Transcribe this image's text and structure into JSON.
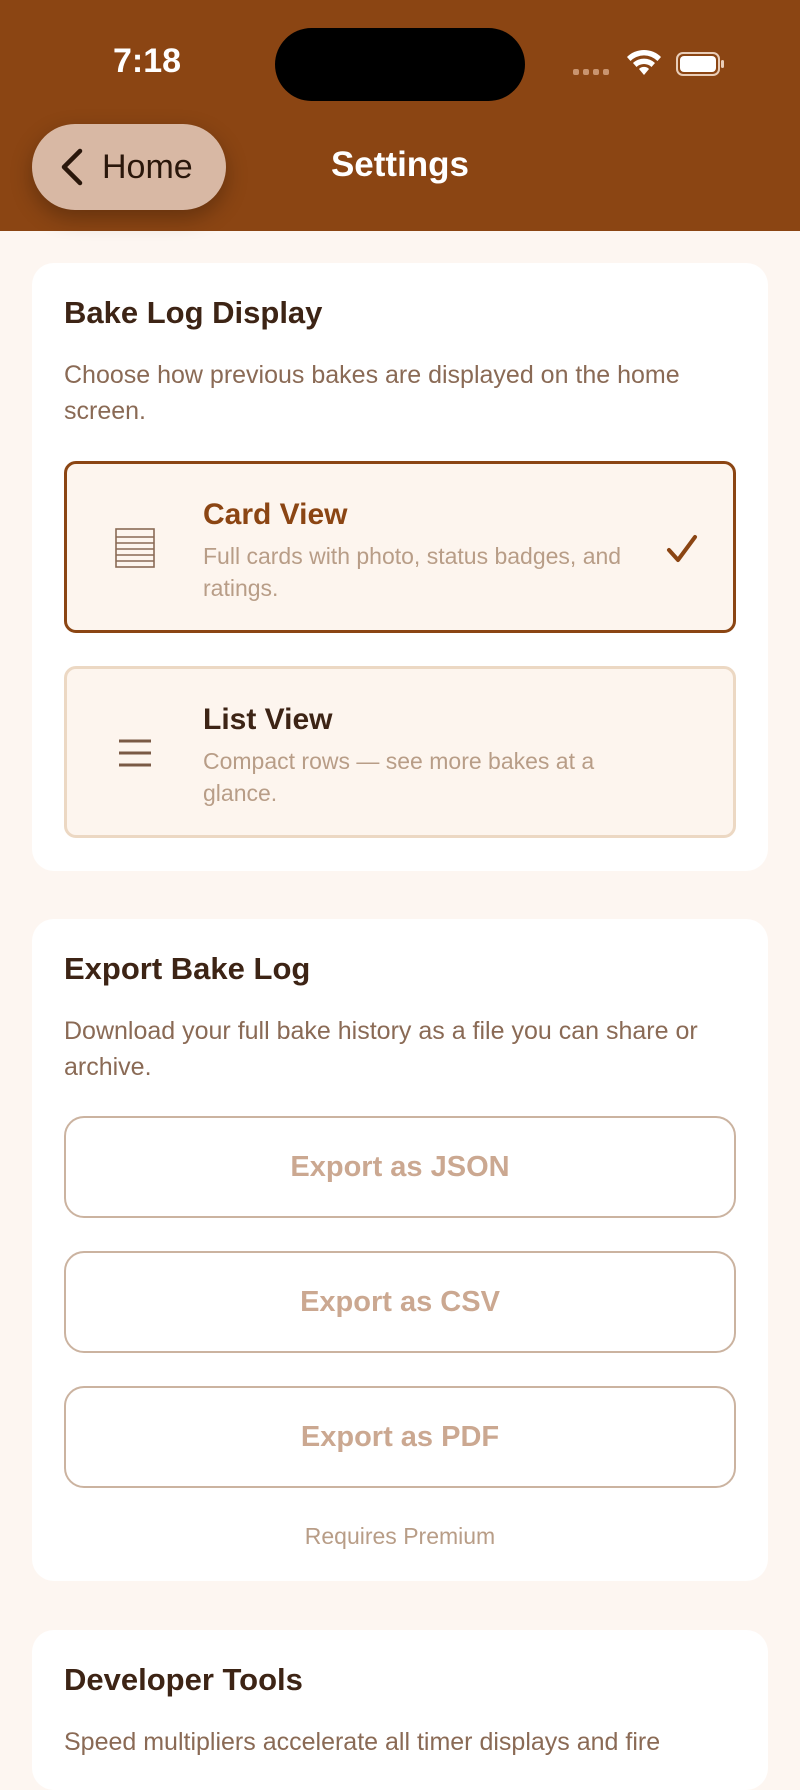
{
  "status_bar": {
    "time": "7:18"
  },
  "nav": {
    "back_label": "Home",
    "title": "Settings"
  },
  "bake_log_display": {
    "title": "Bake Log Display",
    "description": "Choose how previous bakes are displayed on the home screen.",
    "options": [
      {
        "title": "Card View",
        "description": "Full cards with photo, status badges, and ratings.",
        "icon": "card-view-icon",
        "selected": true
      },
      {
        "title": "List View",
        "description": "Compact rows — see more bakes at a glance.",
        "icon": "list-view-icon",
        "selected": false
      }
    ]
  },
  "export": {
    "title": "Export Bake Log",
    "description": "Download your full bake history as a file you can share or archive.",
    "buttons": [
      "Export as JSON",
      "Export as CSV",
      "Export as PDF"
    ],
    "note": "Requires Premium"
  },
  "developer_tools": {
    "title": "Developer Tools",
    "description": "Speed multipliers accelerate all timer displays and fire"
  },
  "colors": {
    "header": "#8b4513",
    "accent": "#8b4513",
    "background": "#fdf6f1",
    "disabled_text": "#cba891"
  }
}
